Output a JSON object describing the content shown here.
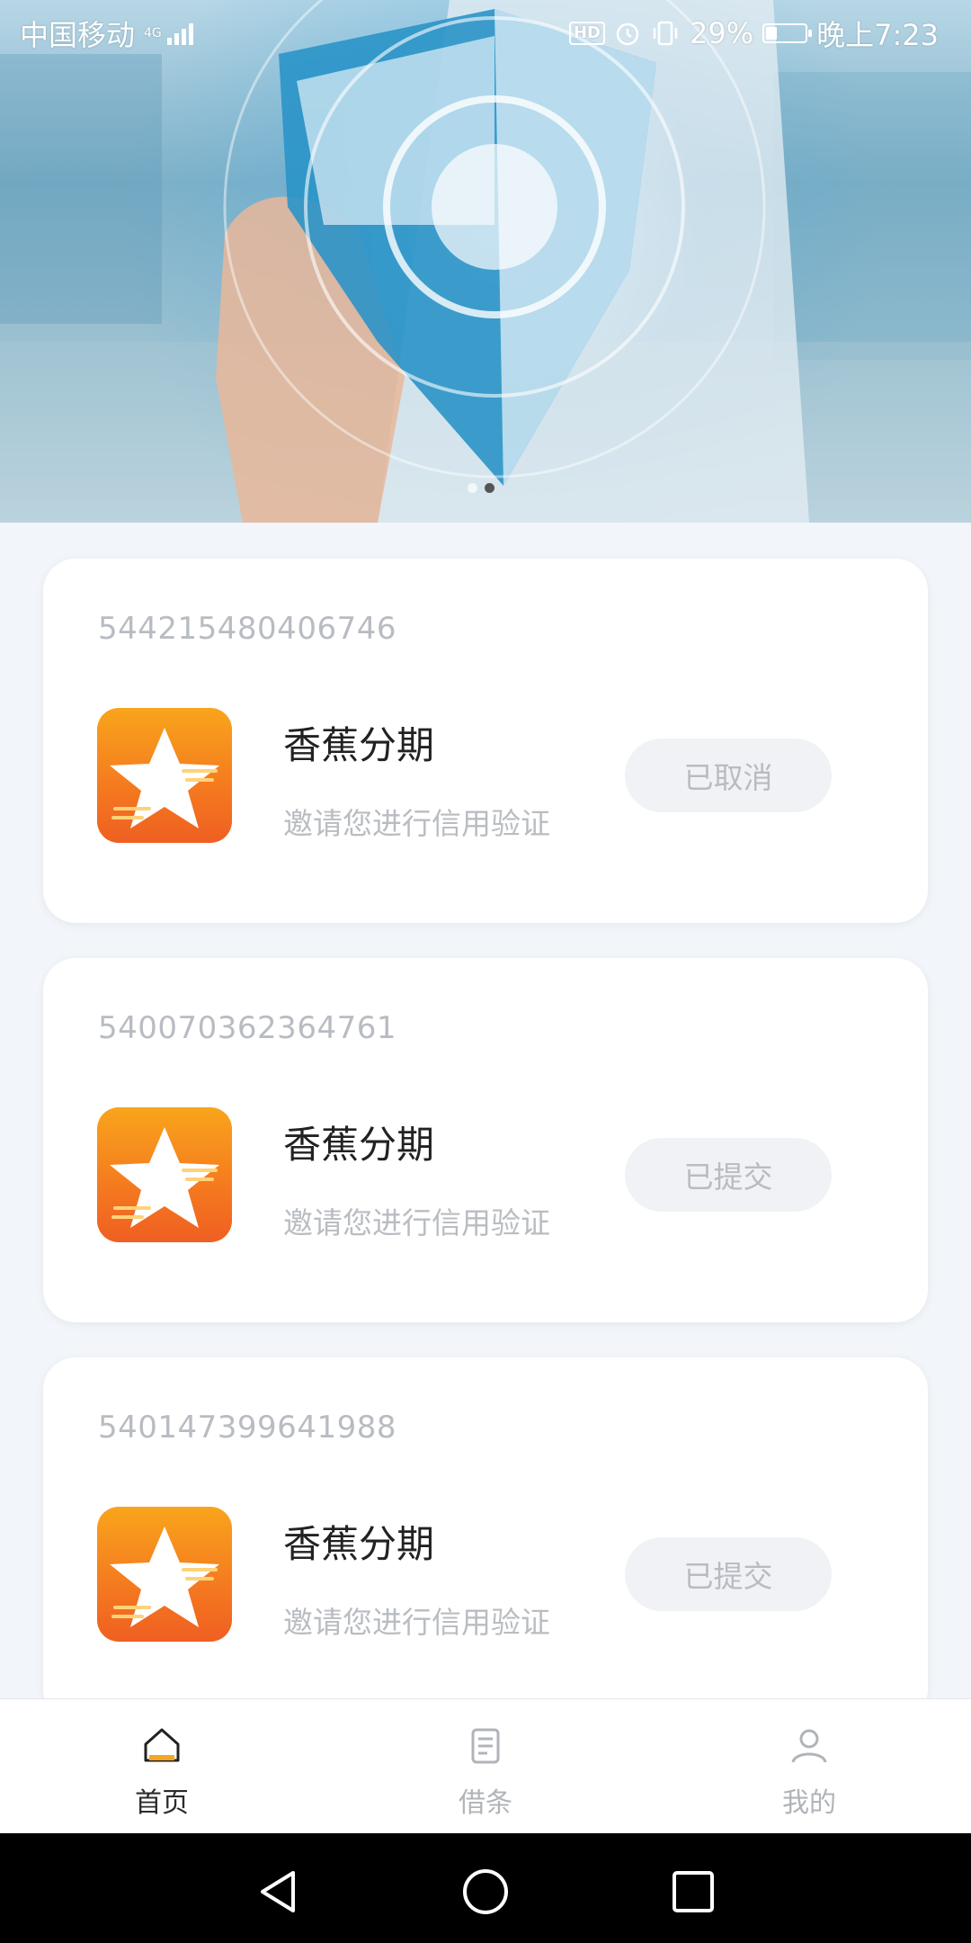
{
  "status_bar": {
    "carrier": "中国移动",
    "network": "4G",
    "hd": "HD",
    "battery": "29%",
    "time": "晚上7:23",
    "battery_level": 0.29
  },
  "banner": {
    "dots": 2,
    "active_dot": 1
  },
  "cards": [
    {
      "order_no": "544215480406746",
      "app_name": "香蕉分期",
      "desc": "邀请您进行信用验证",
      "status": "已取消"
    },
    {
      "order_no": "540070362364761",
      "app_name": "香蕉分期",
      "desc": "邀请您进行信用验证",
      "status": "已提交"
    },
    {
      "order_no": "540147399641988",
      "app_name": "香蕉分期",
      "desc": "邀请您进行信用验证",
      "status": "已提交"
    }
  ],
  "tabbar": {
    "items": [
      {
        "label": "首页",
        "icon": "home-icon",
        "active": true
      },
      {
        "label": "借条",
        "icon": "document-icon",
        "active": false
      },
      {
        "label": "我的",
        "icon": "user-icon",
        "active": false
      }
    ]
  },
  "colors": {
    "accent_orange": "#f57c1f",
    "page_bg": "#f2f5f9",
    "muted_text": "#b8bcc2"
  }
}
